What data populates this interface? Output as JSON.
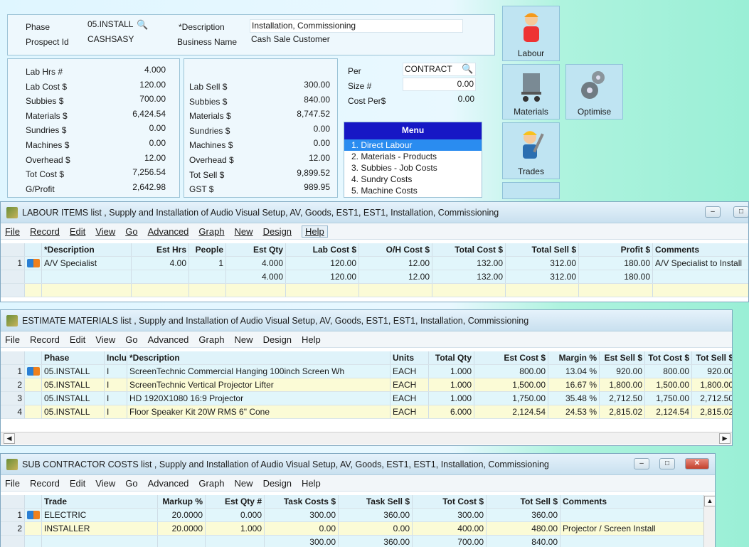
{
  "header": {
    "phase_label": "Phase",
    "phase_value": "05.INSTALL",
    "prospect_label": "Prospect Id",
    "prospect_value": "CASHSASY",
    "desc_label": "*Description",
    "desc_value": "Installation, Commissioning",
    "business_label": "Business Name",
    "business_value": "Cash Sale Customer"
  },
  "costs": [
    {
      "label": "Lab Hrs #",
      "value": "4.000"
    },
    {
      "label": "Lab Cost $",
      "value": "120.00"
    },
    {
      "label": "Subbies  $",
      "value": "700.00"
    },
    {
      "label": "Materials $",
      "value": "6,424.54"
    },
    {
      "label": "Sundries  $",
      "value": "0.00"
    },
    {
      "label": "Machines $",
      "value": "0.00"
    },
    {
      "label": "Overhead $",
      "value": "12.00"
    },
    {
      "label": "Tot Cost $",
      "value": "7,256.54"
    },
    {
      "label": "G/Profit",
      "value": "2,642.98"
    }
  ],
  "sells": [
    {
      "label": "Lab Sell $",
      "value": "300.00"
    },
    {
      "label": "Subbies  $",
      "value": "840.00"
    },
    {
      "label": "Materials $",
      "value": "8,747.52"
    },
    {
      "label": "Sundries  $",
      "value": "0.00"
    },
    {
      "label": "Machines $",
      "value": "0.00"
    },
    {
      "label": "Overhead $",
      "value": "12.00"
    },
    {
      "label": "Tot Sell $",
      "value": "9,899.52"
    },
    {
      "label": "GST  $",
      "value": "989.95"
    }
  ],
  "per": {
    "per_label": "Per",
    "per_value": "CONTRACT",
    "size_label": "Size #",
    "size_value": "0.00",
    "costper_label": "Cost Per$",
    "costper_value": "0.00"
  },
  "menu": {
    "title": "Menu",
    "items": [
      "1. Direct Labour",
      "2. Materials - Products",
      "3. Subbies - Job Costs",
      "4. Sundry Costs",
      "5. Machine Costs"
    ]
  },
  "tiles": {
    "labour": "Labour",
    "materials": "Materials",
    "optimise": "Optimise",
    "trades": "Trades"
  },
  "labour": {
    "title": "LABOUR ITEMS list , Supply and Installation of Audio Visual Setup, AV, Goods, EST1, EST1, Installation, Commissioning",
    "menus": [
      "File",
      "Record",
      "Edit",
      "View",
      "Go",
      "Advanced",
      "Graph",
      "New",
      "Design",
      "Help"
    ],
    "headers": [
      "*Description",
      "Est Hrs",
      "People",
      "Est Qty",
      "Lab Cost $",
      "O/H Cost $",
      "Total Cost $",
      "Total Sell $",
      "Profit $",
      "Comments"
    ],
    "rows": [
      [
        "1",
        "A/V Specialist",
        "4.00",
        "1",
        "4.000",
        "120.00",
        "12.00",
        "132.00",
        "312.00",
        "180.00",
        "A/V Specialist to Install"
      ]
    ],
    "totals": [
      "4.000",
      "120.00",
      "12.00",
      "132.00",
      "312.00",
      "180.00"
    ]
  },
  "materials": {
    "title": "ESTIMATE MATERIALS list , Supply and Installation of Audio Visual Setup, AV, Goods, EST1, EST1, Installation, Commissioning",
    "menus": [
      "File",
      "Record",
      "Edit",
      "View",
      "Go",
      "Advanced",
      "Graph",
      "New",
      "Design",
      "Help"
    ],
    "headers": [
      "Phase",
      "Inclu",
      "*Description",
      "Units",
      "Total Qty",
      "Est Cost  $",
      "Margin %",
      "Est Sell  $",
      "Tot Cost $",
      "Tot Sell $"
    ],
    "rows": [
      [
        "1",
        "05.INSTALL",
        "I",
        "ScreenTechnic Commercial Hanging 100inch Screen Wh",
        "EACH",
        "1.000",
        "800.00",
        "13.04 %",
        "920.00",
        "800.00",
        "920.00"
      ],
      [
        "2",
        "05.INSTALL",
        "I",
        "ScreenTechnic Vertical Projector Lifter",
        "EACH",
        "1.000",
        "1,500.00",
        "16.67 %",
        "1,800.00",
        "1,500.00",
        "1,800.00"
      ],
      [
        "3",
        "05.INSTALL",
        "I",
        "HD 1920X1080 16:9 Projector",
        "EACH",
        "1.000",
        "1,750.00",
        "35.48 %",
        "2,712.50",
        "1,750.00",
        "2,712.50"
      ],
      [
        "4",
        "05.INSTALL",
        "I",
        "Floor Speaker Kit 20W RMS 6\" Cone",
        "EACH",
        "6.000",
        "2,124.54",
        "24.53 %",
        "2,815.02",
        "2,124.54",
        "2,815.02"
      ]
    ]
  },
  "subs": {
    "title": "SUB CONTRACTOR COSTS list , Supply and Installation of Audio Visual Setup, AV, Goods, EST1, EST1, Installation, Commissioning",
    "menus": [
      "File",
      "Record",
      "Edit",
      "View",
      "Go",
      "Advanced",
      "Graph",
      "New",
      "Design",
      "Help"
    ],
    "headers": [
      "Trade",
      "Markup %",
      "Est Qty #",
      "Task Costs $",
      "Task Sell $",
      "Tot Cost $",
      "Tot Sell $",
      "Comments"
    ],
    "rows": [
      [
        "1",
        "ELECTRIC",
        "20.0000",
        "0.000",
        "300.00",
        "360.00",
        "300.00",
        "360.00",
        ""
      ],
      [
        "2",
        "INSTALLER",
        "20.0000",
        "1.000",
        "0.00",
        "0.00",
        "400.00",
        "480.00",
        "Projector / Screen Install"
      ]
    ],
    "totals": [
      "300.00",
      "360.00",
      "700.00",
      "840.00"
    ]
  }
}
